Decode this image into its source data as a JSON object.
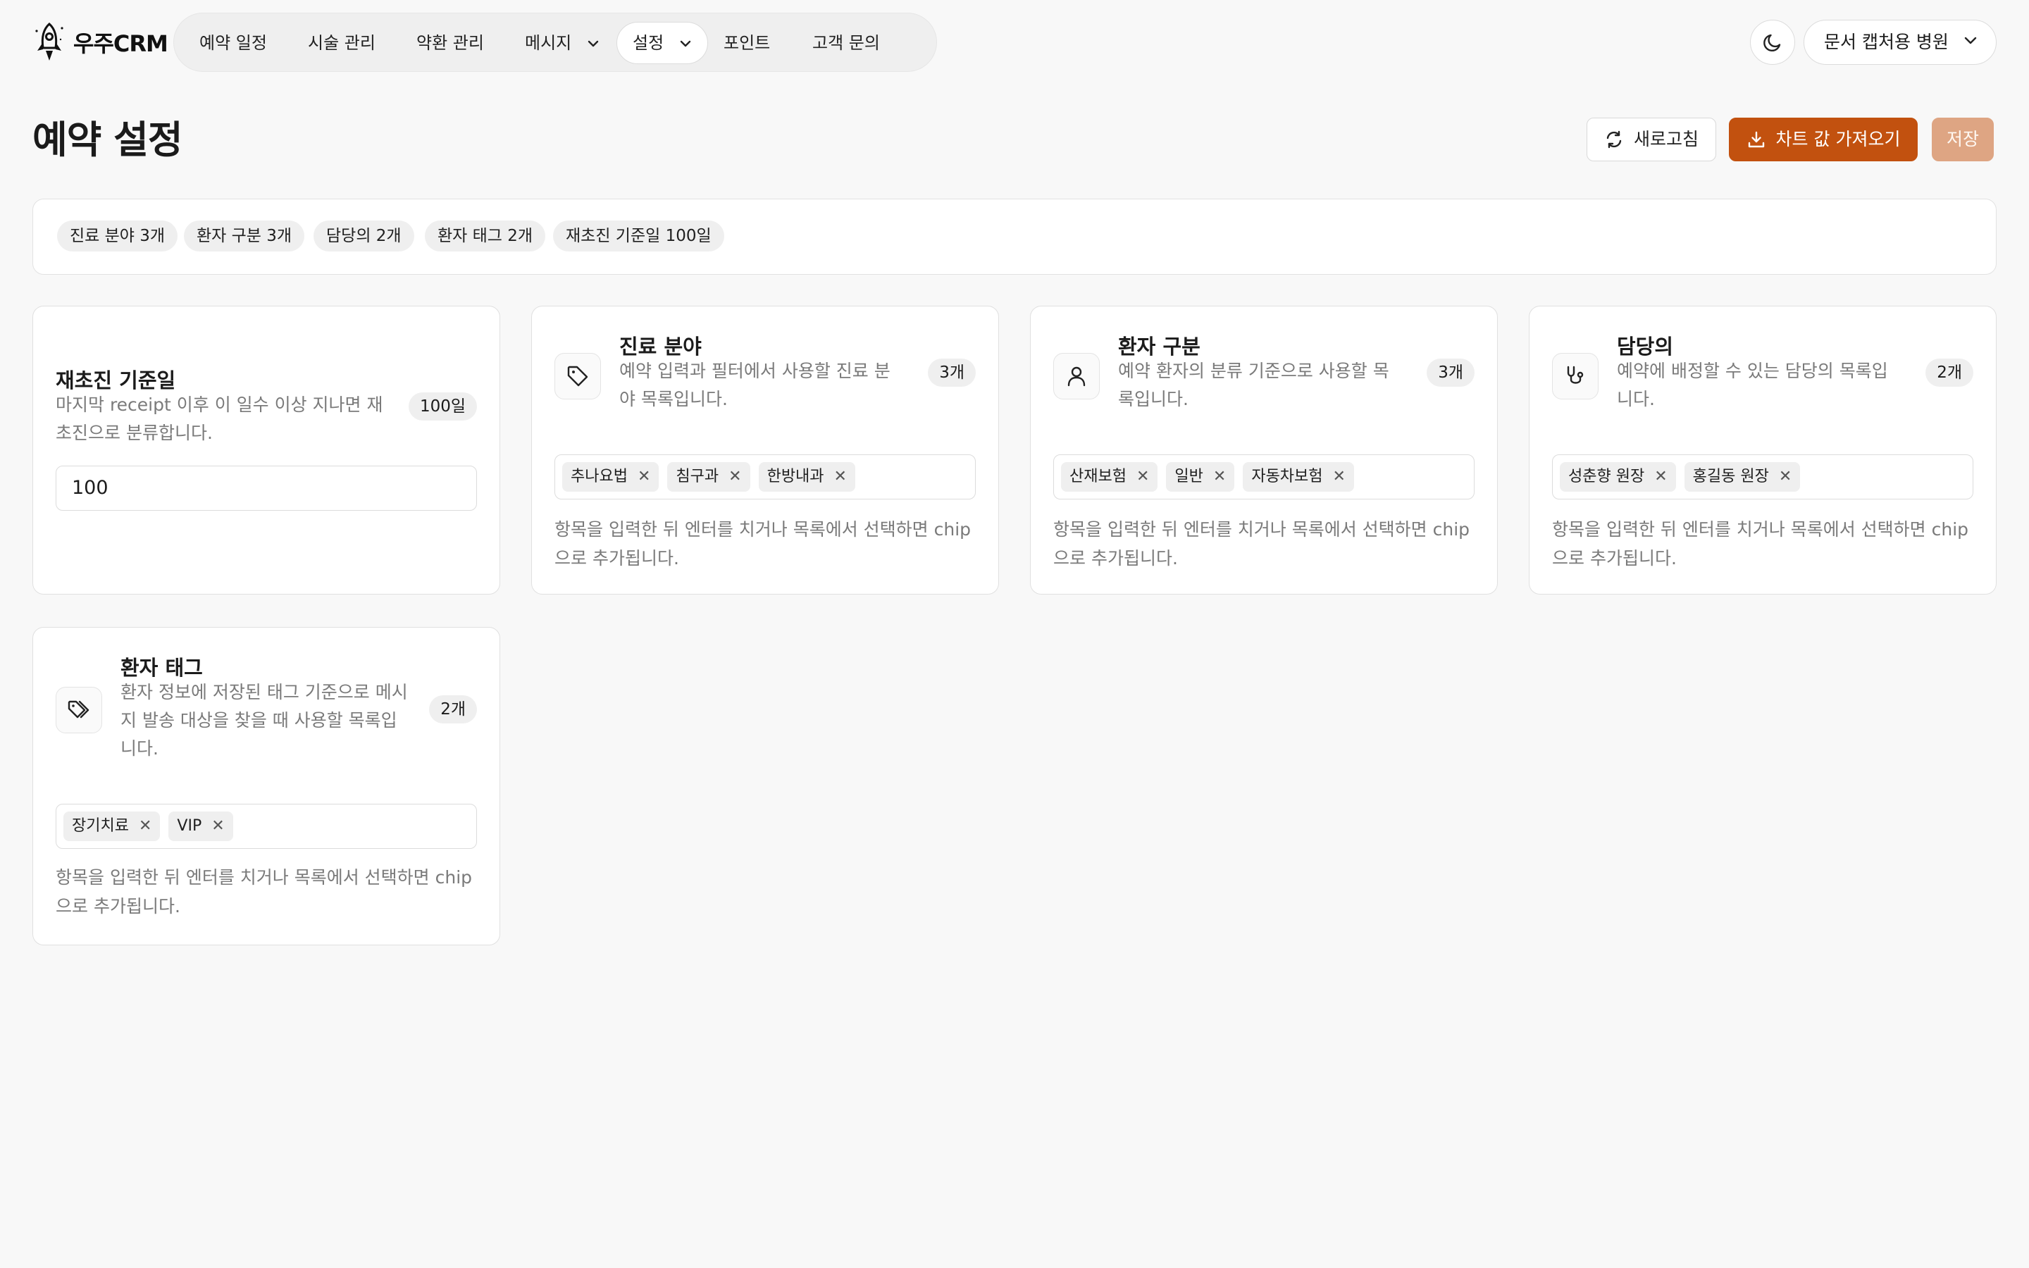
{
  "app": {
    "logo_text": "우주CRM"
  },
  "nav": {
    "items": [
      {
        "label": "예약 일정"
      },
      {
        "label": "시술 관리"
      },
      {
        "label": "약환 관리"
      },
      {
        "label": "메시지"
      },
      {
        "label": "설정"
      },
      {
        "label": "포인트"
      },
      {
        "label": "고객 문의"
      }
    ],
    "clinic_label": "문서 캡처용 병원"
  },
  "header": {
    "title": "예약 설정",
    "refresh_label": "새로고침",
    "import_label": "차트 값 가져오기",
    "save_label": "저장"
  },
  "summary": {
    "tags": [
      "진료 분야 3개",
      "환자 구분 3개",
      "담당의 2개",
      "환자 태그 2개",
      "재초진 기준일 100일"
    ]
  },
  "revisit": {
    "title": "재초진 기준일",
    "desc": "마지막 receipt 이후 이 일수 이상 지나면 재초진으로 분류합니다.",
    "badge": "100일",
    "value": "100"
  },
  "cards": [
    {
      "title": "진료 분야",
      "desc": "예약 입력과 필터에서 사용할 진료 분야 목록입니다.",
      "count": "3개",
      "icon": "tag-icon",
      "chips": [
        "추나요법",
        "침구과",
        "한방내과"
      ],
      "helper": "항목을 입력한 뒤 엔터를 치거나 목록에서 선택하면 chip으로 추가됩니다."
    },
    {
      "title": "환자 구분",
      "desc": "예약 환자의 분류 기준으로 사용할 목록입니다.",
      "count": "3개",
      "icon": "user-icon",
      "chips": [
        "산재보험",
        "일반",
        "자동차보험"
      ],
      "helper": "항목을 입력한 뒤 엔터를 치거나 목록에서 선택하면 chip으로 추가됩니다."
    },
    {
      "title": "담당의",
      "desc": "예약에 배정할 수 있는 담당의 목록입니다.",
      "count": "2개",
      "icon": "stethoscope-icon",
      "chips": [
        "성춘향 원장",
        "홍길동 원장"
      ],
      "helper": "항목을 입력한 뒤 엔터를 치거나 목록에서 선택하면 chip으로 추가됩니다."
    },
    {
      "title": "환자 태그",
      "desc": "환자 정보에 저장된 태그 기준으로 메시지 발송 대상을 찾을 때 사용할 목록입니다.",
      "count": "2개",
      "icon": "tags-icon",
      "chips": [
        "장기치료",
        "VIP"
      ],
      "helper": "항목을 입력한 뒤 엔터를 치거나 목록에서 선택하면 chip으로 추가됩니다."
    }
  ]
}
